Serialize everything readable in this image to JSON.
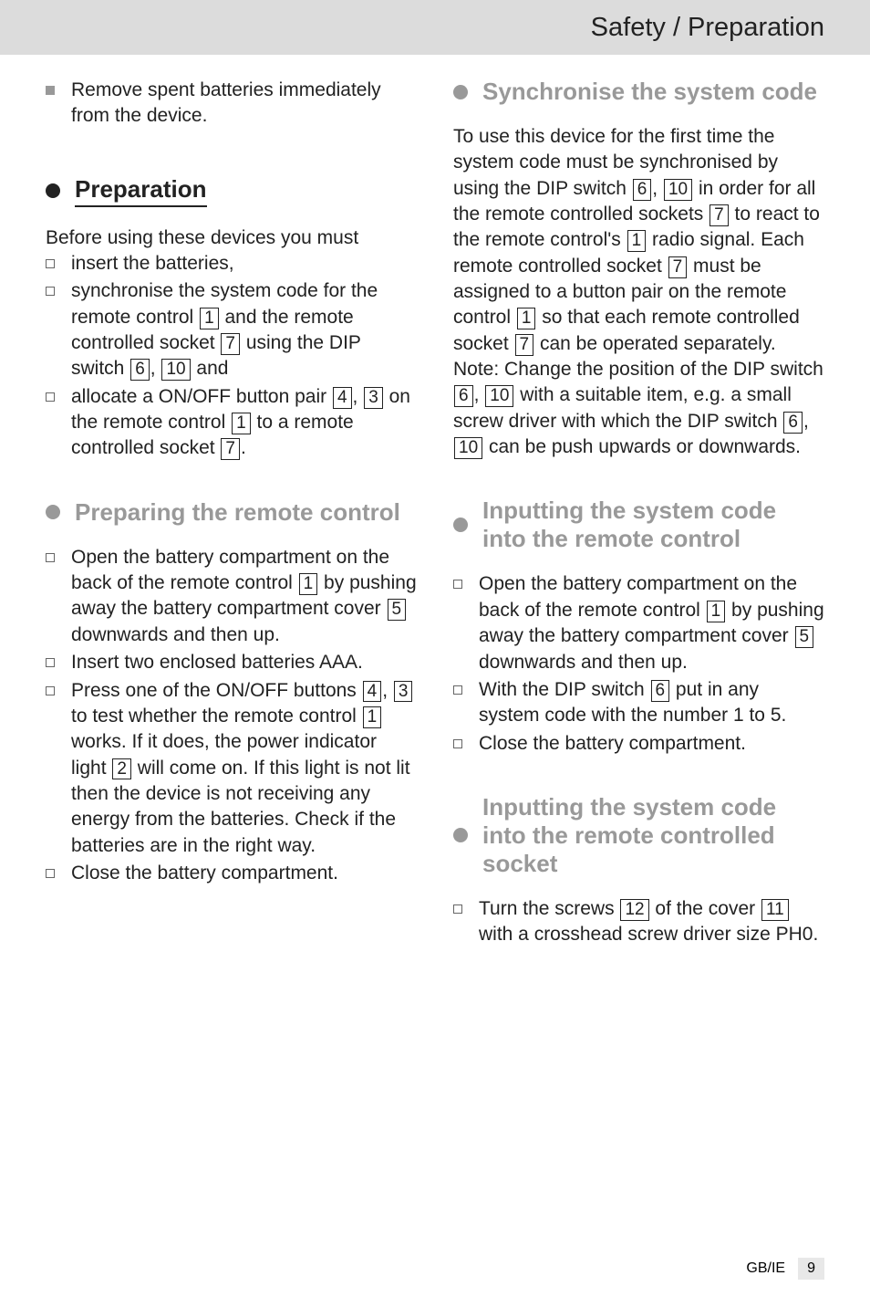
{
  "header": {
    "title": "Safety / Preparation"
  },
  "left": {
    "intro_item": "Remove spent batteries immediately from the device.",
    "h_prep": "Preparation",
    "prep_intro": "Before using these devices you must",
    "prep_items": {
      "a": "insert the batteries,",
      "b1": "synchronise the system code for the remote control ",
      "b2": " and the remote controlled socket ",
      "b3": " using the DIP switch ",
      "b4": ", ",
      "b5": " and",
      "c1": "allocate a ON/OFF button pair ",
      "c2": ", ",
      "c3": " on the remote control ",
      "c4": " to a remote controlled socket ",
      "c5": "."
    },
    "h_remote": "Preparing the remote control",
    "remote_items": {
      "a1": "Open the battery compartment on the back of the remote control ",
      "a2": " by pushing away the battery compartment cover ",
      "a3": " downwards and then up.",
      "b": "Insert two enclosed batteries AAA.",
      "c1": "Press one of the ON/OFF buttons ",
      "c2": ", ",
      "c3": " to test whether the remote control ",
      "c4": " works. If it does, the power indicator light ",
      "c5": " will come on. If this light is not lit then the device is not receiving any energy from the batteries. Check if the batteries are in the right way.",
      "d": "Close the battery compartment."
    }
  },
  "right": {
    "h_sync": "Synchronise the system code",
    "sync_p": {
      "s1": "To use this device for the first time the system code must be synchronised by using the DIP switch ",
      "s2": ", ",
      "s3": " in order for all the remote controlled sockets ",
      "s4": " to react to the remote control's ",
      "s5": " radio signal. Each remote controlled socket ",
      "s6": " must be assigned to a button pair on the remote control ",
      "s7": " so that each remote controlled socket ",
      "s8": " can be operated separately. ",
      "note": "Note:",
      "s9": " Change the position of the DIP switch ",
      "s10": ", ",
      "s11": " with a suitable item, e.g. a small screw driver with which the DIP switch ",
      "s12": ", ",
      "s13": " can be push upwards or downwards."
    },
    "h_input_remote": "Inputting the system code into the remote control",
    "input_remote": {
      "a1": "Open the battery compartment on the back of the remote control ",
      "a2": " by pushing away the battery compartment cover ",
      "a3": " downwards and then up.",
      "b1": "With the DIP switch ",
      "b2": " put in any system code with the number 1 to 5.",
      "c": "Close the battery compartment."
    },
    "h_input_socket": "Inputting the system code into the remote controlled socket",
    "input_socket": {
      "a1": "Turn the screws ",
      "a2": " of the cover ",
      "a3": " with a crosshead screw driver size PH0."
    }
  },
  "nums": {
    "n1": "1",
    "n2": "2",
    "n3": "3",
    "n4": "4",
    "n5": "5",
    "n6": "6",
    "n7": "7",
    "n10": "10",
    "n11": "11",
    "n12": "12"
  },
  "footer": {
    "region": "GB/IE",
    "page": "9"
  }
}
